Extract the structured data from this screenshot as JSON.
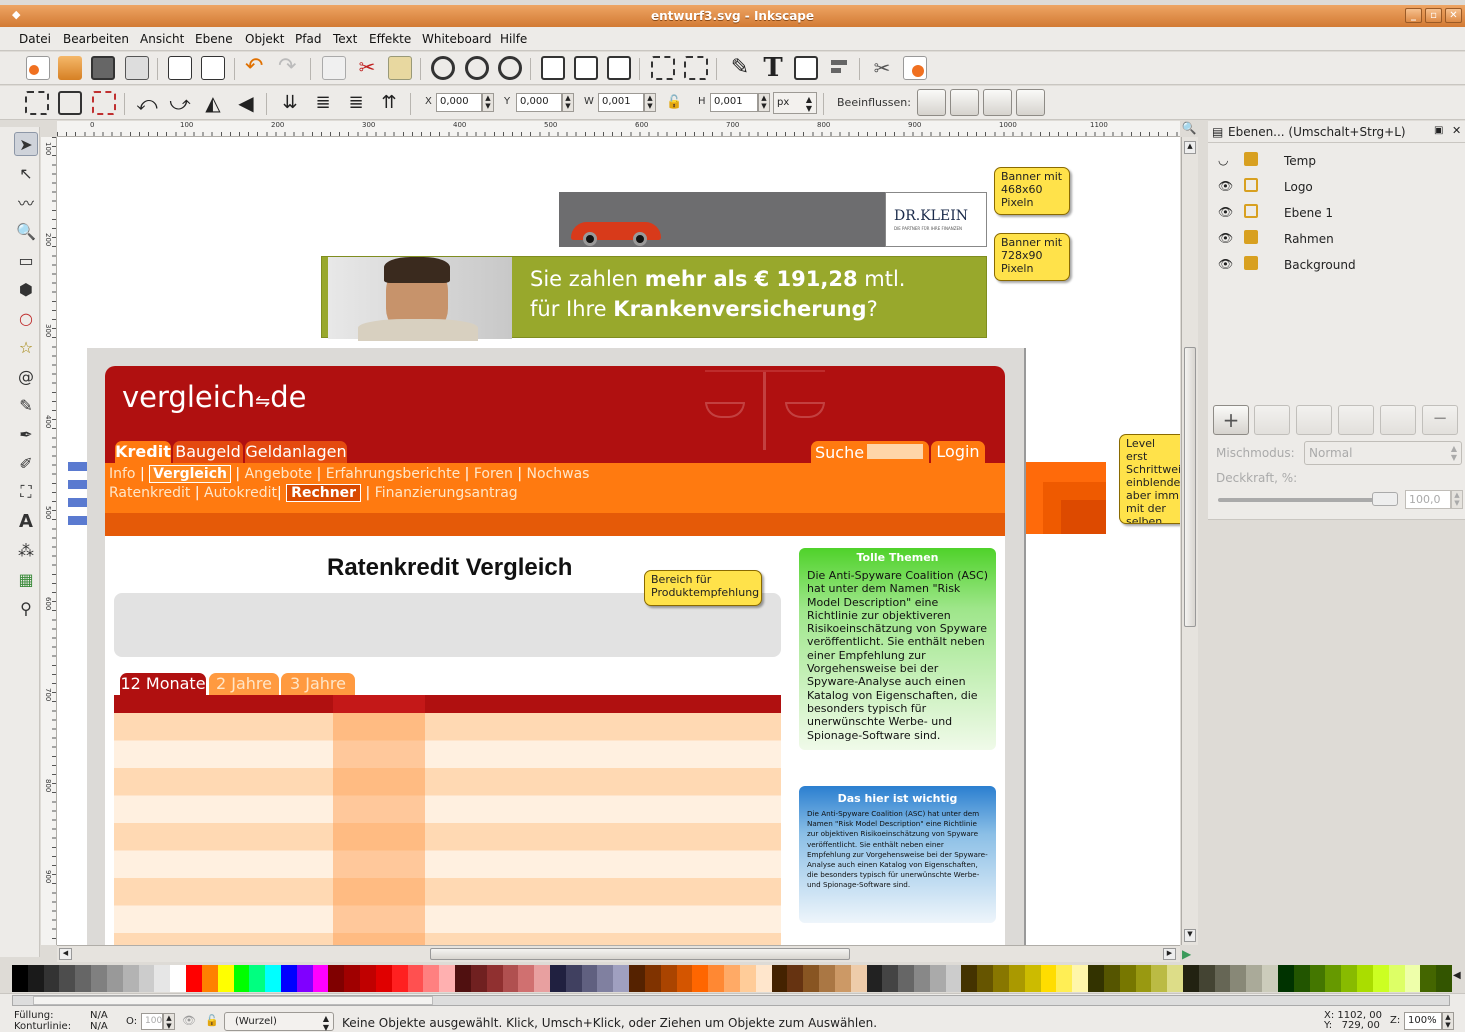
{
  "window": {
    "title": "entwurf3.svg - Inkscape"
  },
  "menu": [
    "Datei",
    "Bearbeiten",
    "Ansicht",
    "Ebene",
    "Objekt",
    "Pfad",
    "Text",
    "Effekte",
    "Whiteboard",
    "Hilfe"
  ],
  "controls": {
    "x_label": "X",
    "x_value": "0,000",
    "y_label": "Y",
    "y_value": "0,000",
    "w_label": "W",
    "w_value": "0,001",
    "h_label": "H",
    "h_value": "0,001",
    "unit": "px",
    "affect_label": "Beeinflussen:"
  },
  "ruler_top": [
    "0",
    "100",
    "200",
    "300",
    "400",
    "500",
    "600",
    "700",
    "800",
    "900",
    "1000",
    "1100"
  ],
  "ruler_left": [
    "100",
    "200",
    "300",
    "400",
    "500",
    "600",
    "700",
    "800",
    "900"
  ],
  "layers_panel": {
    "title": "Ebenen... (Umschalt+Strg+L)",
    "layers": [
      "Temp",
      "Logo",
      "Ebene 1",
      "Rahmen",
      "Background"
    ],
    "blend_label": "Mischmodus:",
    "blend_value": "Normal",
    "opacity_label": "Deckkraft, %:",
    "opacity_value": "100,0"
  },
  "design": {
    "banner_small_brand": "DR.KLEIN",
    "banner_small_tagline": "DIE PARTNER FÜR IHRE FINANZEN",
    "banner_large_line1a": "Sie zahlen ",
    "banner_large_line1b": "mehr als € 191,28",
    "banner_large_line1c": " mtl.",
    "banner_large_line2a": "für Ihre ",
    "banner_large_line2b": "Krankenversicherung",
    "banner_large_line2c": "?",
    "logo": "vergleich",
    "logo_suffix": "de",
    "nav_tabs": [
      "Kredit",
      "Baugeld",
      "Geldanlagen"
    ],
    "search_label": "Suche",
    "login_label": "Login",
    "subnav1": [
      "Info",
      "Vergleich",
      "Angebote",
      "Erfahrungsberichte",
      "Foren",
      "Nochwas"
    ],
    "subnav2": [
      "Ratenkredit",
      "Autokredit",
      "Rechner",
      "Finanzierungsantrag"
    ],
    "heading": "Ratenkredit Vergleich",
    "term_tabs": [
      "12 Monate",
      "2 Jahre",
      "3 Jahre"
    ],
    "green_box_title": "Tolle Themen",
    "green_box_text": "Die Anti-Spyware Coalition (ASC) hat unter dem Namen \"Risk Model Description\" eine Richtlinie zur objektiveren Risikoeinschätzung von Spyware veröffentlicht. Sie enthält neben einer Empfehlung zur Vorgehensweise bei der Spyware-Analyse auch einen Katalog von Eigenschaften, die besonders typisch für unerwünschte Werbe- und Spionage-Software sind.",
    "blue_box_title": "Das hier ist wichtig",
    "blue_box_text": "Die Anti-Spyware Coalition (ASC) hat unter dem Namen \"Risk Model Description\" eine Richtlinie zur objektiven Risikoeinschätzung von Spyware veröffentlicht. Sie enthält neben einer Empfehlung zur Vorgehensweise bei der Spyware-Analyse auch einen Katalog von Eigenschaften, die besonders typisch für unerwünschte Werbe- und Spionage-Software sind."
  },
  "callouts": {
    "c1": "Banner mit\n468x60\nPixeln",
    "c2": "Banner mit\n728x90\nPixeln",
    "c3": "Bereich für\nProduktempfehlung",
    "c4": "Level erst\nSchrittwei\neinblende\naber imm\nmit der\nselben Hö"
  },
  "palette": [
    "#000000",
    "#1a1a1a",
    "#333333",
    "#4d4d4d",
    "#666666",
    "#808080",
    "#999999",
    "#b3b3b3",
    "#cccccc",
    "#e6e6e6",
    "#ffffff",
    "#ff0000",
    "#ff8000",
    "#ffff00",
    "#00ff00",
    "#00ff80",
    "#00ffff",
    "#0000ff",
    "#8000ff",
    "#ff00ff",
    "#800000",
    "#a00000",
    "#c00000",
    "#e00000",
    "#ff2020",
    "#ff5050",
    "#ff8080",
    "#ffb0b0",
    "#501010",
    "#702020",
    "#903030",
    "#b05050",
    "#d07070",
    "#e8a0a0",
    "#202040",
    "#404060",
    "#606080",
    "#8080a0",
    "#a0a0c0",
    "#552200",
    "#803300",
    "#aa4400",
    "#d45500",
    "#ff6600",
    "#ff8833",
    "#ffaa66",
    "#ffcc99",
    "#ffe6cc",
    "#442200",
    "#663311",
    "#885522",
    "#aa7744",
    "#cc9966",
    "#eeccaa",
    "#222222",
    "#444444",
    "#666666",
    "#888888",
    "#aaaaaa",
    "#cccccc",
    "#443300",
    "#665500",
    "#887700",
    "#aa9900",
    "#ccbb00",
    "#ffdd00",
    "#ffee55",
    "#fff6aa",
    "#333300",
    "#555500",
    "#777700",
    "#999911",
    "#bbbb44",
    "#dddd88",
    "#222211",
    "#444433",
    "#666655",
    "#888877",
    "#aaaa99",
    "#ccccbb",
    "#003300",
    "#225500",
    "#447700",
    "#669900",
    "#88bb00",
    "#aadd00",
    "#ccff22",
    "#ddff66",
    "#eeffaa",
    "#446600",
    "#335500"
  ],
  "status": {
    "fill_label": "Füllung:",
    "fill_value": "N/A",
    "stroke_label": "Konturlinie:",
    "stroke_value": "N/A",
    "opacity_label": "O:",
    "opacity_value": "100",
    "layer_value": "(Wurzel)",
    "message": "Keine Objekte ausgewählt. Klick, Umsch+Klick, oder Ziehen um Objekte zum Auswählen.",
    "x_coord": "X: 1102, 00",
    "y_coord": "Y:   729, 00",
    "zoom_label": "Z:",
    "zoom_value": "100%"
  }
}
